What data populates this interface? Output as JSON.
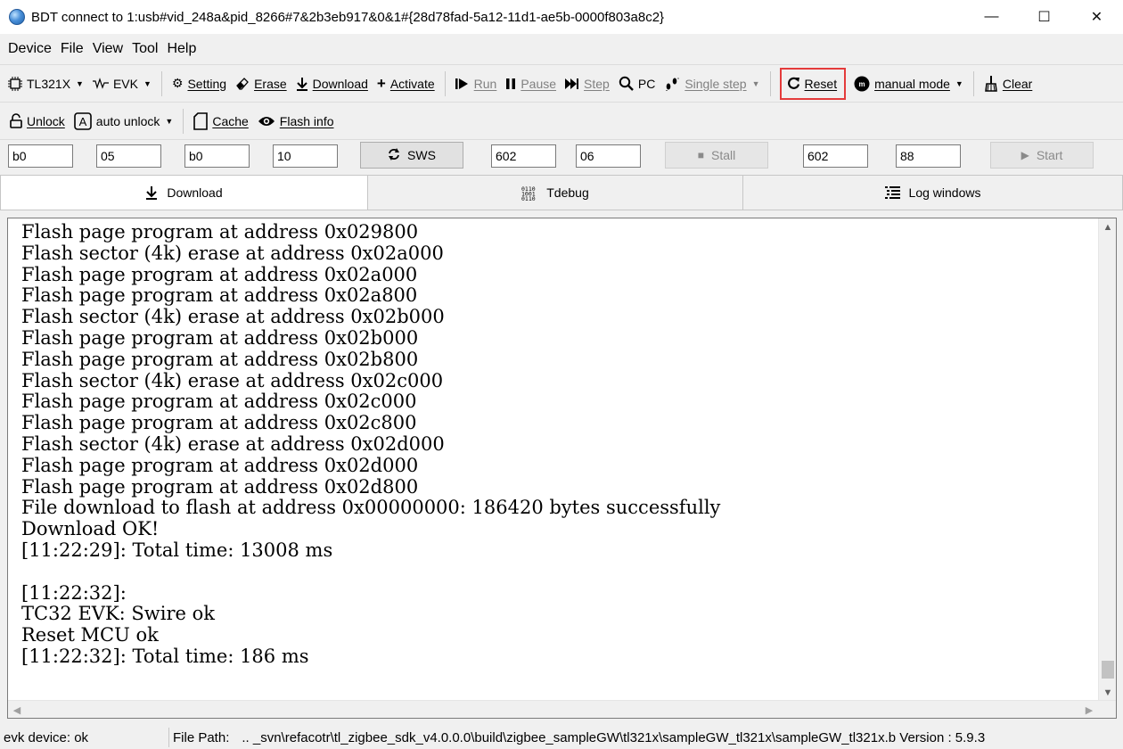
{
  "window": {
    "title": "BDT connect to 1:usb#vid_248a&pid_8266#7&2b3eb917&0&1#{28d78fad-5a12-11d1-ae5b-0000f803a8c2}",
    "minimize": "—",
    "maximize": "☐",
    "close": "✕"
  },
  "menu": [
    "Device",
    "File",
    "View",
    "Tool",
    "Help"
  ],
  "toolbar1": {
    "chip": "TL321X",
    "evk": "EVK",
    "setting": "Setting",
    "erase": "Erase",
    "download": "Download",
    "activate": "Activate",
    "run": "Run",
    "pause": "Pause",
    "step": "Step",
    "pc": "PC",
    "single_step": "Single step",
    "reset": "Reset",
    "mode": "manual mode",
    "clear": "Clear"
  },
  "toolbar2": {
    "unlock": "Unlock",
    "auto_unlock": "auto unlock",
    "cache": "Cache",
    "flash_info": "Flash info"
  },
  "registers": {
    "f1": "b0",
    "f2": "05",
    "f3": "b0",
    "f4": "10",
    "sws": "SWS",
    "f5": "602",
    "f6": "06",
    "stall": "Stall",
    "f7": "602",
    "f8": "88",
    "start": "Start"
  },
  "tabs": {
    "download": "Download",
    "tdebug": "Tdebug",
    "log": "Log windows",
    "active": "download"
  },
  "log": {
    "text": "Flash page program at address 0x029800\nFlash sector (4k) erase at address 0x02a000\nFlash page program at address 0x02a000\nFlash page program at address 0x02a800\nFlash sector (4k) erase at address 0x02b000\nFlash page program at address 0x02b000\nFlash page program at address 0x02b800\nFlash sector (4k) erase at address 0x02c000\nFlash page program at address 0x02c000\nFlash page program at address 0x02c800\nFlash sector (4k) erase at address 0x02d000\nFlash page program at address 0x02d000\nFlash page program at address 0x02d800\nFile download to flash at address 0x00000000: 186420 bytes successfully\nDownload OK!\n[11:22:29]: Total time: 13008 ms\n\n[11:22:32]:\nTC32 EVK: Swire ok\nReset MCU ok\n[11:22:32]: Total time: 186 ms"
  },
  "status": {
    "device": "evk device: ok",
    "file_path_label": "File Path:",
    "file_path": "..  _svn\\refacotr\\tl_zigbee_sdk_v4.0.0.0\\build\\zigbee_sampleGW\\tl321x\\sampleGW_tl321x\\sampleGW_tl321x.b",
    "version": "Version : 5.9.3"
  },
  "colors": {
    "highlight": "#e43b3b",
    "background": "#f0f0f0"
  }
}
